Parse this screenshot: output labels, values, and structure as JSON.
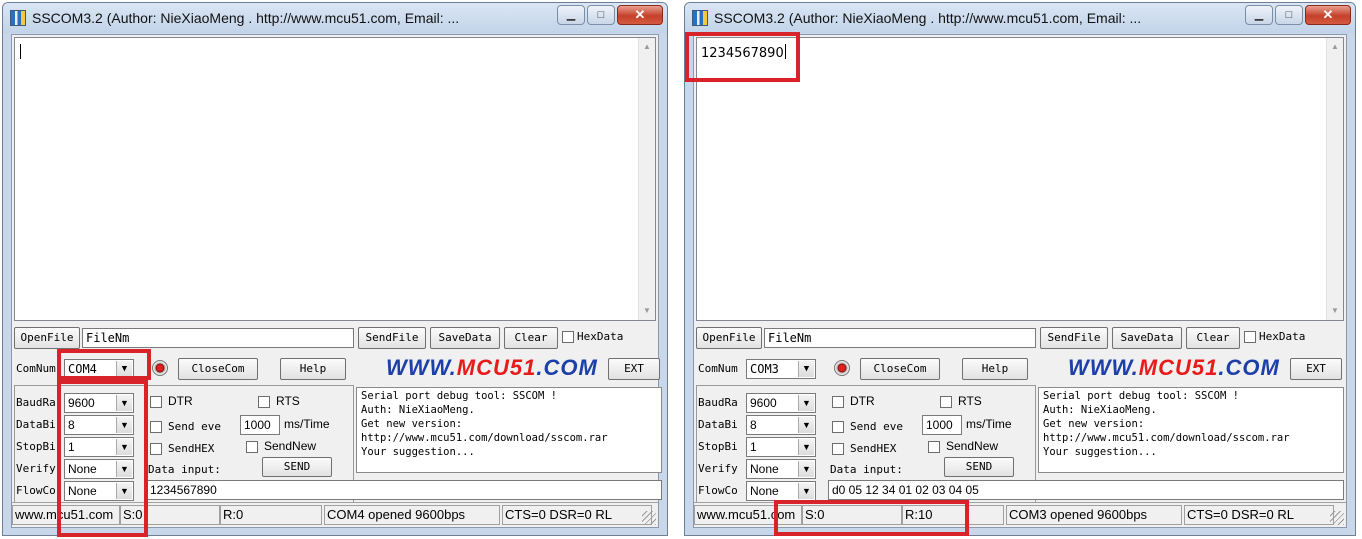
{
  "windows": [
    {
      "title": "SSCOM3.2 (Author: NieXiaoMeng . http://www.mcu51.com, Email: ...",
      "receive_text": "",
      "open_file_label": "OpenFile",
      "filename_value": "FileNm",
      "send_file_label": "SendFile",
      "save_data_label": "SaveData",
      "clear_label": "Clear",
      "hexdata_label": "HexData",
      "comnum_label": "ComNum",
      "com_port": "COM4",
      "close_com_label": "CloseCom",
      "help_label": "Help",
      "logo_prefix": "WWW.",
      "logo_brand": "MCU51",
      "logo_suffix": ".COM",
      "ext_label": "EXT",
      "baud_label": "BaudRa",
      "baud_value": "9600",
      "databits_label": "DataBi",
      "databits_value": "8",
      "stopbits_label": "StopBi",
      "stopbits_value": "1",
      "verify_label": "Verify",
      "verify_value": "None",
      "flow_label": "FlowCo",
      "flow_value": "None",
      "dtr_label": "DTR",
      "rts_label": "RTS",
      "send_every_label": "Send eve",
      "interval_value": "1000",
      "interval_unit": "ms/Time",
      "sendhex_label": "SendHEX",
      "sendnew_label": "SendNew",
      "send_label": "SEND",
      "data_input_label": "Data input:",
      "info_text": "Serial port debug tool: SSCOM !\nAuth: NieXiaoMeng.\nGet new version:\nhttp://www.mcu51.com/download/sscom.rar\nYour suggestion...",
      "data_input_value": "1234567890",
      "status_site": "www.mcu51.com",
      "status_sent": "S:0",
      "status_recv": "R:0",
      "status_port": "COM4 opened 9600bps",
      "status_lines": "CTS=0 DSR=0 RL"
    },
    {
      "title": "SSCOM3.2 (Author: NieXiaoMeng . http://www.mcu51.com, Email: ...",
      "receive_text": "1234567890",
      "open_file_label": "OpenFile",
      "filename_value": "FileNm",
      "send_file_label": "SendFile",
      "save_data_label": "SaveData",
      "clear_label": "Clear",
      "hexdata_label": "HexData",
      "comnum_label": "ComNum",
      "com_port": "COM3",
      "close_com_label": "CloseCom",
      "help_label": "Help",
      "logo_prefix": "WWW.",
      "logo_brand": "MCU51",
      "logo_suffix": ".COM",
      "ext_label": "EXT",
      "baud_label": "BaudRa",
      "baud_value": "9600",
      "databits_label": "DataBi",
      "databits_value": "8",
      "stopbits_label": "StopBi",
      "stopbits_value": "1",
      "verify_label": "Verify",
      "verify_value": "None",
      "flow_label": "FlowCo",
      "flow_value": "None",
      "dtr_label": "DTR",
      "rts_label": "RTS",
      "send_every_label": "Send eve",
      "interval_value": "1000",
      "interval_unit": "ms/Time",
      "sendhex_label": "SendHEX",
      "sendnew_label": "SendNew",
      "send_label": "SEND",
      "data_input_label": "Data input:",
      "info_text": "Serial port debug tool: SSCOM !\nAuth: NieXiaoMeng.\nGet new version:\nhttp://www.mcu51.com/download/sscom.rar\nYour suggestion...",
      "data_input_value": "d0 05 12 34 01 02 03 04 05",
      "status_site": "www.mcu51.com",
      "status_sent": "S:0",
      "status_recv": "R:10",
      "status_port": "COM3 opened 9600bps",
      "status_lines": "CTS=0 DSR=0 RL"
    }
  ],
  "icons": [
    "app-icon",
    "minimize-icon",
    "maximize-icon",
    "close-icon",
    "record-icon",
    "dropdown-arrow-icon",
    "scroll-up-icon",
    "scroll-down-icon",
    "resize-grip-icon"
  ],
  "colors": {
    "highlight": "#d8232a",
    "logo_blue": "#1d3fa8",
    "logo_red": "#e81b1b",
    "titlebar": "#c8d7ea"
  }
}
